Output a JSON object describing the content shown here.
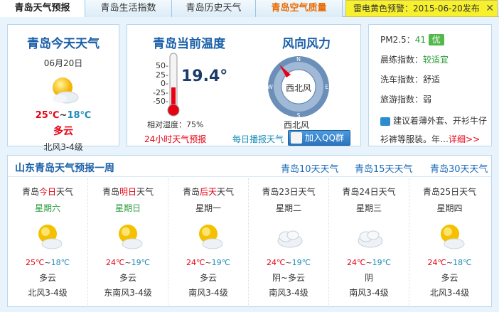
{
  "tabs": [
    {
      "label": "青岛天气预报"
    },
    {
      "label": "青岛生活指数"
    },
    {
      "label": "青岛历史天气"
    },
    {
      "label": "青岛空气质量"
    }
  ],
  "alert": {
    "text": "雷电黄色预警：2015-06-20发布",
    "close": "✕"
  },
  "today": {
    "title": "青岛今天天气",
    "date": "06月20日",
    "high": "25℃",
    "sep": "~",
    "low": "18℃",
    "condition": "多云",
    "wind": "北风3-4级"
  },
  "current": {
    "title": "青岛当前温度",
    "scale": [
      "50-",
      "25-",
      "0-",
      "-25-",
      "-50-"
    ],
    "temperature": "19.4°",
    "humidity": "相对湿度：75%",
    "hourly_link": "24小时天气预报",
    "wind_title": "风向风力",
    "wind_dir_center": "西北风",
    "wind_dir": "西北风",
    "daily_link": "每日播报天气",
    "qq_button": "加入QQ群"
  },
  "indices": {
    "pm_label": "PM2.5：",
    "pm_value": "41",
    "pm_level": "优",
    "morning_label": "晨练指数：",
    "morning_value": "较适宜",
    "car_label": "洗车指数：",
    "car_value": "舒适",
    "travel_label": "旅游指数：",
    "travel_value": "弱",
    "advice": "建议着薄外套、开衫牛仔衫裤等服装。年…",
    "detail": "详细>>"
  },
  "week": {
    "title": "山东青岛天气预报一周",
    "links": [
      "青岛10天天气",
      "青岛15天天气",
      "青岛30天天气"
    ],
    "days": [
      {
        "prefix": "青岛",
        "hl": "今日",
        "suffix": "天气",
        "weekday": "星期六",
        "high": "25℃",
        "low": "18℃",
        "cond": "多云",
        "wind": "北风3-4级",
        "icon": "sun-cloud"
      },
      {
        "prefix": "青岛",
        "hl": "明日",
        "suffix": "天气",
        "weekday": "星期日",
        "high": "24℃",
        "low": "19℃",
        "cond": "多云",
        "wind": "东南风3-4级",
        "icon": "sun-cloud"
      },
      {
        "prefix": "青岛",
        "hl": "后天",
        "suffix": "天气",
        "weekday": "星期一",
        "high": "24℃",
        "low": "19℃",
        "cond": "多云",
        "wind": "南风3-4级",
        "icon": "sun-cloud"
      },
      {
        "prefix": "青岛",
        "hl": "",
        "suffix": "23日天气",
        "weekday": "星期二",
        "high": "24℃",
        "low": "19℃",
        "cond": "阴~多云",
        "wind": "南风3-4级",
        "icon": "cloud"
      },
      {
        "prefix": "青岛",
        "hl": "",
        "suffix": "24日天气",
        "weekday": "星期三",
        "high": "24℃",
        "low": "19℃",
        "cond": "阴",
        "wind": "南风3-4级",
        "icon": "cloud"
      },
      {
        "prefix": "青岛",
        "hl": "",
        "suffix": "25日天气",
        "weekday": "星期四",
        "high": "24℃",
        "low": "18℃",
        "cond": "多云",
        "wind": "北风3-4级",
        "icon": "sun-cloud"
      }
    ]
  },
  "colors": {
    "accent": "#1a5fa8",
    "hot": "#e60012",
    "cool": "#1a8cb8",
    "good": "#53b74b",
    "alert": "#f7f02c"
  }
}
